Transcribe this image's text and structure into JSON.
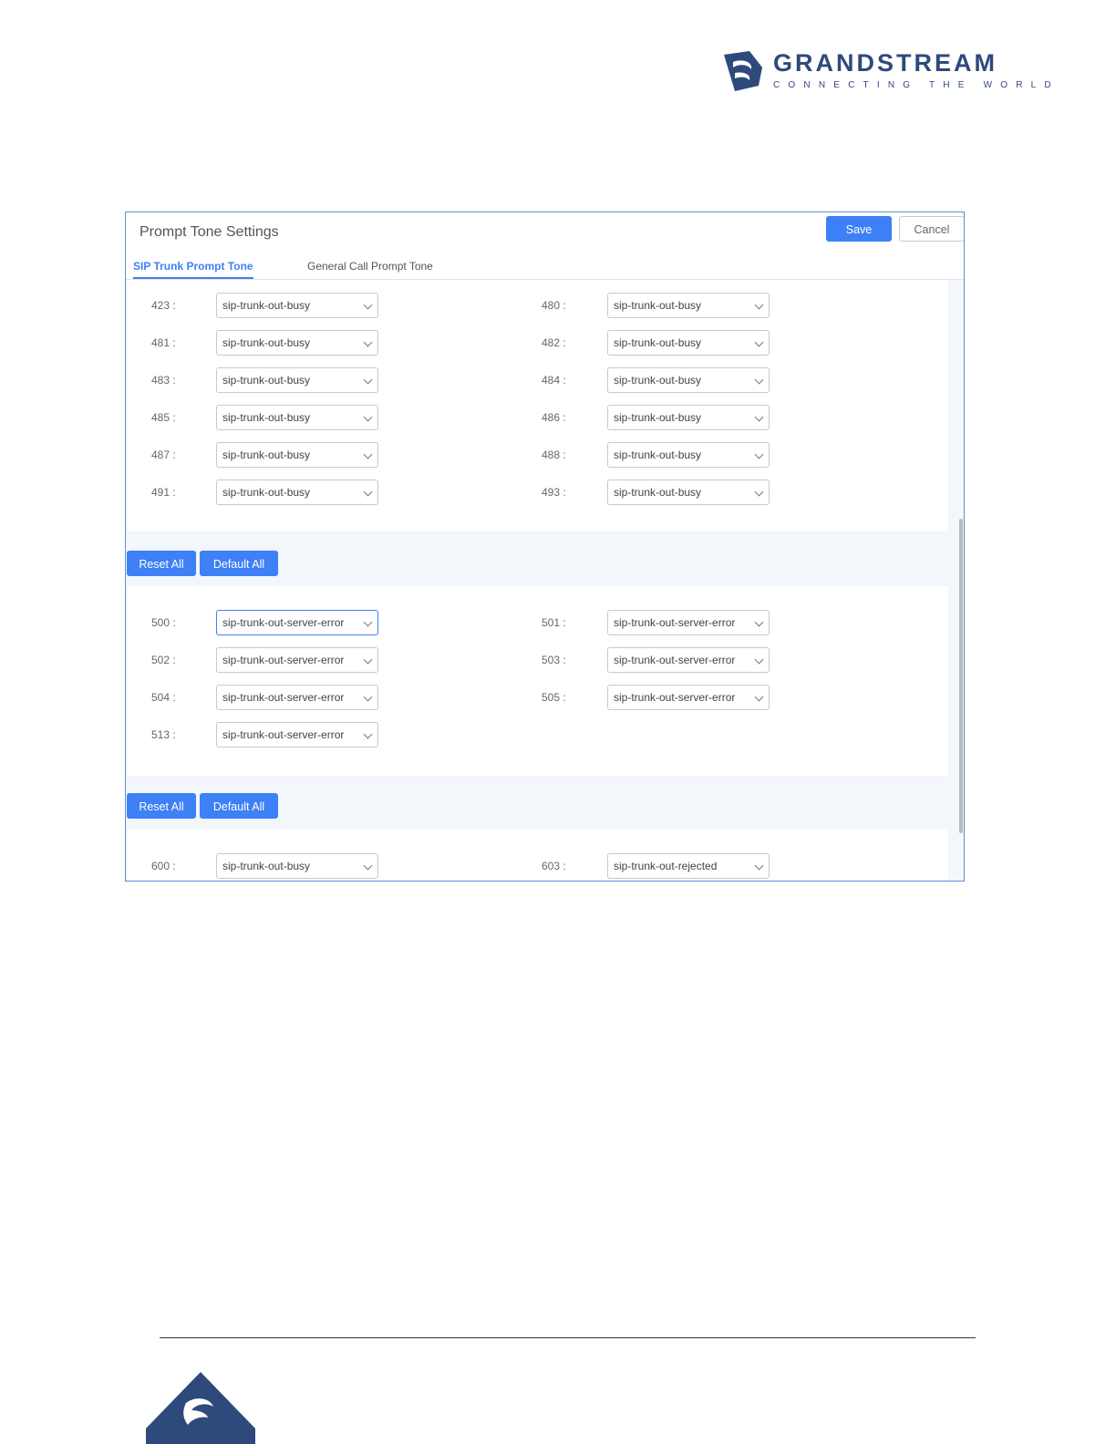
{
  "brand": {
    "name": "GRANDSTREAM",
    "tagline": "CONNECTING THE WORLD",
    "primary_color": "#2e4a7c"
  },
  "panel": {
    "title": "Prompt Tone Settings",
    "save_label": "Save",
    "cancel_label": "Cancel",
    "tabs": [
      {
        "label": "SIP Trunk Prompt Tone",
        "active": true
      },
      {
        "label": "General Call Prompt Tone",
        "active": false
      }
    ],
    "accent_color": "#3e80f5"
  },
  "sections": [
    {
      "rows": [
        {
          "left": {
            "code": "423 :",
            "value": "sip-trunk-out-busy"
          },
          "right": {
            "code": "480 :",
            "value": "sip-trunk-out-busy"
          }
        },
        {
          "left": {
            "code": "481 :",
            "value": "sip-trunk-out-busy"
          },
          "right": {
            "code": "482 :",
            "value": "sip-trunk-out-busy"
          }
        },
        {
          "left": {
            "code": "483 :",
            "value": "sip-trunk-out-busy"
          },
          "right": {
            "code": "484 :",
            "value": "sip-trunk-out-busy"
          }
        },
        {
          "left": {
            "code": "485 :",
            "value": "sip-trunk-out-busy"
          },
          "right": {
            "code": "486 :",
            "value": "sip-trunk-out-busy"
          }
        },
        {
          "left": {
            "code": "487 :",
            "value": "sip-trunk-out-busy"
          },
          "right": {
            "code": "488 :",
            "value": "sip-trunk-out-busy"
          }
        },
        {
          "left": {
            "code": "491 :",
            "value": "sip-trunk-out-busy"
          },
          "right": {
            "code": "493 :",
            "value": "sip-trunk-out-busy"
          }
        }
      ],
      "reset_label": "Reset All",
      "default_label": "Default All"
    },
    {
      "rows": [
        {
          "left": {
            "code": "500 :",
            "value": "sip-trunk-out-server-error"
          },
          "right": {
            "code": "501 :",
            "value": "sip-trunk-out-server-error"
          }
        },
        {
          "left": {
            "code": "502 :",
            "value": "sip-trunk-out-server-error"
          },
          "right": {
            "code": "503 :",
            "value": "sip-trunk-out-server-error"
          }
        },
        {
          "left": {
            "code": "504 :",
            "value": "sip-trunk-out-server-error"
          },
          "right": {
            "code": "505 :",
            "value": "sip-trunk-out-server-error"
          }
        },
        {
          "left": {
            "code": "513 :",
            "value": "sip-trunk-out-server-error"
          }
        }
      ],
      "reset_label": "Reset All",
      "default_label": "Default All"
    },
    {
      "rows": [
        {
          "left": {
            "code": "600 :",
            "value": "sip-trunk-out-busy"
          },
          "right": {
            "code": "603 :",
            "value": "sip-trunk-out-rejected"
          }
        }
      ]
    }
  ]
}
